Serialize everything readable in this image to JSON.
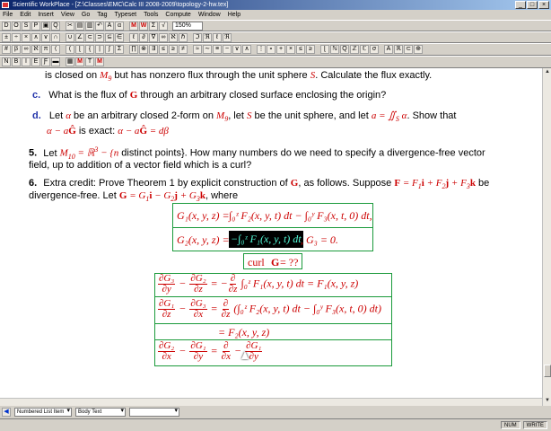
{
  "window": {
    "title": "Scientific WorkPlace - [Z:\\Classes\\EMC\\Calc III 2008-2009\\topology-2-hw.tex]",
    "controls": [
      "_",
      "□",
      "×"
    ]
  },
  "menu": [
    "File",
    "Edit",
    "Insert",
    "View",
    "Go",
    "Tag",
    "Typeset",
    "Tools",
    "Compute",
    "Window",
    "Help"
  ],
  "toolbar": {
    "zoom": "150%",
    "row1": [
      "D",
      "O",
      "S",
      "P",
      "▣",
      "Q",
      "✂",
      "▤",
      "▥",
      "↶",
      "A",
      "α",
      "M",
      "W",
      "Σ",
      "√"
    ],
    "row2": [
      "±",
      "÷",
      "×",
      "∧",
      "∨",
      "∩",
      "∪",
      "∠",
      "⊂",
      "⊃",
      "⊆",
      "∈",
      "ℓ",
      "∂",
      "∇",
      "∞",
      "ℵ",
      "ℏ",
      "ℑ",
      "ℜ",
      "ℓ",
      "ℜ"
    ],
    "row3": [
      "#",
      "β",
      "∞",
      "ℵ",
      "π",
      "⟨",
      "(",
      "[",
      "{",
      "|",
      "∫",
      "Σ",
      "∏",
      "⊗",
      "∃",
      "≤",
      "≥",
      "≠",
      "≈",
      "∼",
      "≡",
      "~",
      "∨",
      "∧",
      "⋮",
      "∘",
      "+",
      "×",
      "≤",
      "≥",
      "[",
      "ℕ",
      "Q",
      "ℤ",
      "ℂ",
      "σ",
      "A",
      "ℝ",
      "⊂",
      "⊕",
      "⊗",
      "∪"
    ],
    "row4": [
      "N",
      "B",
      "I",
      "E",
      "Ƒ",
      "▬",
      "▦",
      "M",
      "T",
      "M"
    ]
  },
  "doc": {
    "line0": {
      "text_a": "is closed on ",
      "m9": "M",
      "m9sub": "9",
      "text_b": " but has nonzero flux through the unit sphere ",
      "s": "S",
      "text_c": ". Calculate the flux exactly."
    },
    "partc": {
      "label": "c.",
      "text_a": "What is the flux of ",
      "g": "G",
      "text_b": " through an arbitrary closed surface enclosing the origin?"
    },
    "partd": {
      "label": "d.",
      "text_a": "Let ",
      "alpha": "α",
      "text_b": " be an arbitrary closed 2-form on ",
      "m9": "M",
      "m9sub": "9",
      "text_c": ", let ",
      "s": "S",
      "text_d": " be the unit sphere, and let ",
      "a": "a",
      "eq": " = ∬",
      "sub_s": "S",
      "alpha2": " α",
      "text_e": ". Show that"
    },
    "partd2": {
      "expr1": "α − a",
      "ghat": "Ĝ",
      "text": " is exact: ",
      "expr2": "α − a",
      "ghat2": "Ĝ",
      "expr3": " = dβ"
    },
    "q5": {
      "label": "5.",
      "text_a": "Let ",
      "m10": "M",
      "m10sub": "10",
      "eq": " = ℝ",
      "sup3": "3",
      "text_b": " − {",
      "n": "n",
      "text_c": " distinct points}. How many numbers do we need to specify a divergence-free vector"
    },
    "q5b": {
      "text": "field, up to addition of a vector field which is a curl?"
    },
    "q6": {
      "label": "6.",
      "text_a": "Extra credit: Prove Theorem 1 by explicit construction of ",
      "g": "G",
      "text_b": ", as follows. Suppose ",
      "f": "F",
      "text_c": " = ",
      "f1": "F",
      "f1sub": "1",
      "i": "i",
      "plus1": " + ",
      "f2": "F",
      "f2sub": "2",
      "j": "j",
      "plus2": " + ",
      "f3": "F",
      "f3sub": "3",
      "k": "k",
      "text_d": " be"
    },
    "q6b": {
      "text_a": "divergence-free. Let ",
      "g": "G",
      "eq": " = ",
      "g1": "G",
      "g1sub": "1",
      "i": "i",
      "minus": " − ",
      "g2": "G",
      "g2sub": "2",
      "j": "j",
      "plus": " + ",
      "g3": "G",
      "g3sub": "3",
      "k": "k",
      "text_b": ", where"
    },
    "box1": {
      "row1_lhs": "G₁(x, y, z) = ",
      "row1_rhs": "∫₀ᶻ F₂(x, y, t) dt − ∫₀ʸ F₃(x, t, 0) dt,",
      "row2_lhs": "G₂(x, y, z) = ",
      "row2_hl": "−∫₀ᶻ F₁(x, y, t) dt",
      "row2_rest": ",     G₃ = 0."
    },
    "curl": {
      "text": "curl ",
      "g": "G",
      "eq": " = ??"
    },
    "box2": {
      "r1_a_num": "∂G₃",
      "r1_a_den": "∂y",
      "r1_minus": " − ",
      "r1_b_num": "∂G₂",
      "r1_b_den": "∂z",
      "r1_eq": " = −",
      "r1_c_num": "∂",
      "r1_c_den": "∂z",
      "r1_rest": " ∫₀ᶻ F₁(x, y, t) dt = F₁(x, y, z)",
      "r2_a_num": "∂G₁",
      "r2_a_den": "∂z",
      "r2_minus": " − ",
      "r2_b_num": "∂G₃",
      "r2_b_den": "∂x",
      "r2_eq": " = ",
      "r2_c_num": "∂",
      "r2_c_den": "∂z",
      "r2_rest": " (∫₀ᶻ F₂(x, y, t) dt − ∫₀ʸ F₃(x, t, 0) dt)",
      "r3_rest": "= F₂(x, y, z)",
      "r4_a_num": "∂G₂",
      "r4_a_den": "∂x",
      "r4_minus": " − ",
      "r4_b_num": "∂G₁",
      "r4_b_den": "∂y",
      "r4_eq": " = ",
      "r4_c_num": "∂",
      "r4_c_den": "∂x",
      "r4_minus2": " − ",
      "r4_d_num": "∂G₁",
      "r4_d_den": "∂y"
    }
  },
  "tagbar": {
    "list_tag": "Numbered List Item",
    "text_tag": "Body Text",
    "third": ""
  },
  "status": {
    "num": "NUM",
    "write": "WRITE"
  }
}
